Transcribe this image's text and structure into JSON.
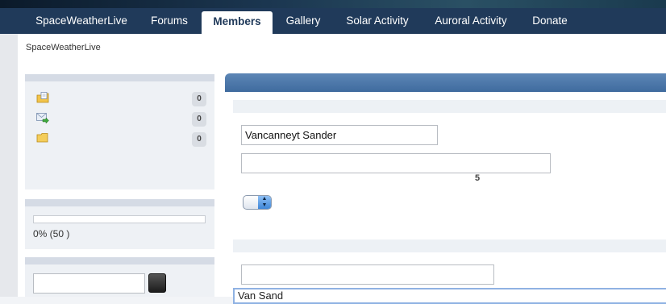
{
  "nav": {
    "tabs": [
      {
        "label": "SpaceWeatherLive"
      },
      {
        "label": "Forums"
      },
      {
        "label": "Members"
      },
      {
        "label": "Gallery"
      },
      {
        "label": "Solar Activity"
      },
      {
        "label": "Auroral Activity"
      },
      {
        "label": "Donate"
      }
    ],
    "active_tab": "Members"
  },
  "breadcrumb": {
    "text": "SpaceWeatherLive"
  },
  "sidebar": {
    "folders": [
      {
        "icon": "folder-document-icon",
        "count": "0"
      },
      {
        "icon": "mail-arrow-icon",
        "count": "0"
      },
      {
        "icon": "folder-icon",
        "count": "0"
      }
    ],
    "progress": {
      "percent": 0,
      "text": "0% (50 )"
    },
    "search": {
      "value": ""
    }
  },
  "main": {
    "name_field": {
      "value": "Vancanneyt Sander"
    },
    "second_field": {
      "value": ""
    },
    "count_text": "5",
    "third_field": {
      "value": ""
    },
    "focused_field": {
      "value": "Van Sand"
    }
  },
  "colors": {
    "nav_bg": "#203a5a",
    "main_bar": "#4a76a8",
    "badge_bg": "#d9dde3"
  }
}
